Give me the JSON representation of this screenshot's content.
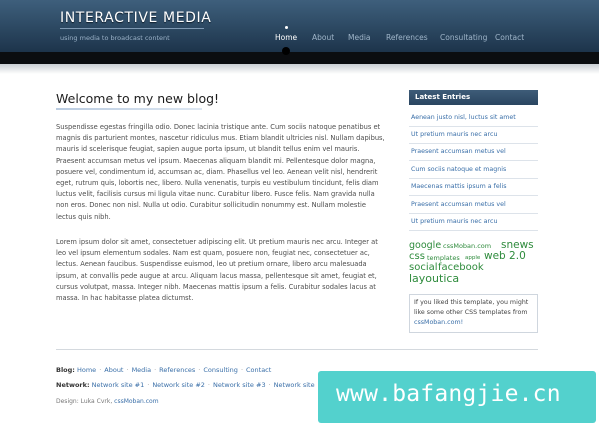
{
  "header": {
    "logo_title": "INTERACTIVE MEDIA",
    "logo_subtitle": "using media to broadcast content",
    "nav": [
      "Home",
      "About",
      "Media",
      "References",
      "Consultating",
      "Contact"
    ]
  },
  "main": {
    "post_title": "Welcome to my new blog!",
    "paragraphs": [
      "Suspendisse egestas fringilla odio. Donec lacinia tristique ante. Cum sociis natoque penatibus et magnis dis parturient montes, nascetur ridiculus mus. Etiam blandit ultricies nisl. Nullam dapibus, mauris id scelerisque feugiat, sapien augue porta ipsum, ut blandit tellus enim vel mauris. Praesent accumsan metus vel ipsum. Maecenas aliquam blandit mi. Pellentesque dolor magna, posuere vel, condimentum id, accumsan ac, diam. Phasellus vel leo. Aenean velit nisl, hendrerit eget, rutrum quis, lobortis nec, libero. Nulla venenatis, turpis eu vestibulum tincidunt, felis diam luctus velit, facilisis cursus mi ligula vitae nunc. Curabitur libero. Fusce felis. Nam gravida nulla non eros. Donec non nisl. Nulla ut odio. Curabitur sollicitudin nonummy est. Nullam molestie lectus quis nibh.",
      "Lorem ipsum dolor sit amet, consectetuer adipiscing elit. Ut pretium mauris nec arcu. Integer at leo vel ipsum elementum sodales. Nam est quam, posuere non, feugiat nec, consectetuer ac, lectus. Aenean faucibus. Suspendisse euismod, leo ut pretium ornare, libero arcu malesuada ipsum, at convallis pede augue at arcu. Aliquam lacus massa, pellentesque sit amet, feugiat et, cursus volutpat, massa. Integer nibh. Maecenas mattis ipsum a felis. Curabitur sodales lacus at massa. In hac habitasse platea dictumst."
    ]
  },
  "sidebar": {
    "latest_heading": "Latest Entries",
    "entries": [
      "Aenean justo nisl, luctus sit amet",
      "Ut pretium mauris nec arcu",
      "Praesent accumsan metus vel",
      "Cum sociis natoque et magnis",
      "Maecenas mattis ipsum a felis",
      "Praesent accumsan metus vel",
      "Ut pretium mauris nec arcu"
    ],
    "tags": [
      "google",
      "cssMoban.com",
      "snews",
      "css",
      "templates",
      "apple",
      "web 2.0",
      "social",
      "facebook",
      "layoutica"
    ],
    "promo_text": "If you liked this template, you might like some other CSS templates from",
    "promo_link": "cssMoban.com!"
  },
  "footer": {
    "blog_label": "Blog:",
    "blog_links": [
      "Home",
      "About",
      "Media",
      "References",
      "Consulting",
      "Contact"
    ],
    "network_label": "Network:",
    "network_links": [
      "Network site #1",
      "Network site #2",
      "Network site #3",
      "Network site"
    ],
    "design_label": "Design: Luka Cvrk,",
    "design_link": "cssMoban.com"
  },
  "watermark": {
    "text": "www.bafangjie.cn"
  },
  "colors": {
    "header_top": "#3e5f7c",
    "header_bottom": "#1d344b",
    "link_blue": "#3a6fa8",
    "tag_green": "#2e8b3c",
    "watermark_bg": "#53d1cd"
  }
}
